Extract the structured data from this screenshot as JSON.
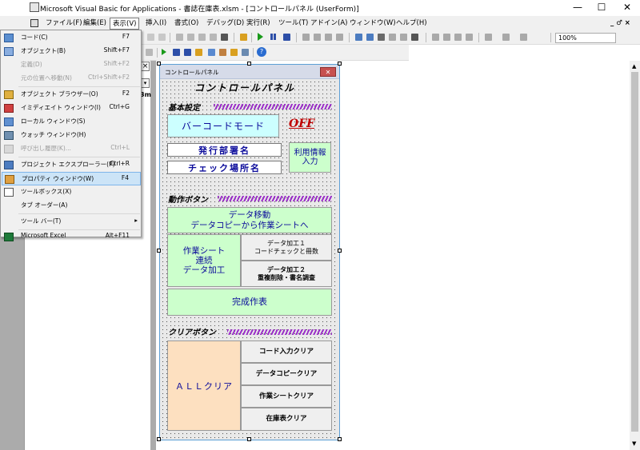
{
  "window": {
    "title": "Microsoft Visual Basic for Applications - 書誌在庫表.xlsm - [コントロールパネル (UserForm)]",
    "minimize": "—",
    "maximize": "☐",
    "close": "✕"
  },
  "menubar": {
    "items": [
      "ファイル(F)",
      "編集(E)",
      "表示(V)",
      "挿入(I)",
      "書式(O)",
      "デバッグ(D)",
      "実行(R)",
      "ツール(T)",
      "アドイン(A)",
      "ウィンドウ(W)",
      "ヘルプ(H)"
    ],
    "right": "_ ♂ ×"
  },
  "toolbar": {
    "zoom": "100%"
  },
  "view_menu": {
    "items": [
      {
        "label": "コード(C)",
        "shortcut": "F7",
        "icon": "code-icon",
        "disabled": false
      },
      {
        "label": "オブジェクト(B)",
        "shortcut": "Shift+F7",
        "icon": "object-icon",
        "disabled": false
      },
      {
        "label": "定義(D)",
        "shortcut": "Shift+F2",
        "icon": "",
        "disabled": true
      },
      {
        "label": "元の位置へ移動(N)",
        "shortcut": "Ctrl+Shift+F2",
        "icon": "",
        "disabled": true
      },
      {
        "label": "オブジェクト ブラウザー(O)",
        "shortcut": "F2",
        "icon": "object-browser-icon",
        "disabled": false
      },
      {
        "label": "イミディエイト ウィンドウ(I)",
        "shortcut": "Ctrl+G",
        "icon": "immediate-window-icon",
        "disabled": false
      },
      {
        "label": "ローカル ウィンドウ(S)",
        "shortcut": "",
        "icon": "locals-window-icon",
        "disabled": false
      },
      {
        "label": "ウォッチ ウィンドウ(H)",
        "shortcut": "",
        "icon": "watch-window-icon",
        "disabled": false
      },
      {
        "label": "呼び出し履歴(K)...",
        "shortcut": "Ctrl+L",
        "icon": "call-stack-icon",
        "disabled": true
      },
      {
        "label": "プロジェクト エクスプローラー(P)",
        "shortcut": "Ctrl+R",
        "icon": "project-explorer-icon",
        "disabled": false
      },
      {
        "label": "プロパティ ウィンドウ(W)",
        "shortcut": "F4",
        "icon": "properties-window-icon",
        "disabled": false,
        "highlight": true
      },
      {
        "label": "ツールボックス(X)",
        "shortcut": "",
        "icon": "toolbox-icon",
        "disabled": false
      },
      {
        "label": "タブ オーダー(A)",
        "shortcut": "",
        "icon": "",
        "disabled": false
      },
      {
        "label": "ツール バー(T)",
        "shortcut": "▸",
        "icon": "",
        "disabled": false
      },
      {
        "label": "Microsoft Excel",
        "shortcut": "Alt+F11",
        "icon": "excel-icon",
        "disabled": false
      }
    ]
  },
  "code_panel": {
    "fragment": "3m"
  },
  "userform": {
    "caption": "コントロールパネル",
    "close": "✕",
    "title": "コントロールパネル",
    "section_basic": "基本設定",
    "barcode_mode": "バーコードモード",
    "off_label": "OFF",
    "issue_dept": "発行部署名",
    "check_place": "チェック場所名",
    "usage_info": "利用情報\n入力",
    "section_actions": "動作ボタン",
    "data_move": "データ移動\nデータコピーから作業シートへ",
    "work_sheet_combo": "作業シート\n連続\nデータ加工",
    "data_proc_1": "データ加工１\nコードチェックと冊数",
    "data_proc_2": "データ加工２\n重複削除・書名調査",
    "make_table": "完成作表",
    "section_clear": "クリアボタン",
    "all_clear": "ＡＬＬクリア",
    "clear_code_input": "コード入力クリア",
    "clear_data_copy": "データコピークリア",
    "clear_work_sheet": "作業シートクリア",
    "clear_stock_table": "在庫表クリア"
  },
  "colors": {
    "form_bg": "#e9e9e9",
    "green_button": "#ccffcc",
    "cyan_button": "#ccffff",
    "peach_button": "#fde0c0",
    "off_red": "#c00000",
    "title_blue": "#0a0a9a",
    "stripe_purple": "#9b30c8",
    "menu_highlight": "#cce4f7"
  }
}
